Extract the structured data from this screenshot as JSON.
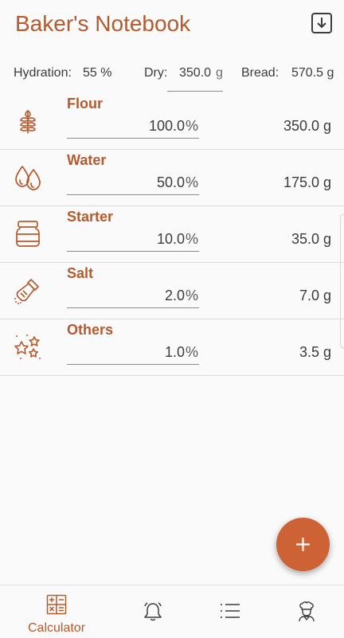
{
  "app": {
    "title": "Baker's Notebook"
  },
  "colors": {
    "accent": "#b55a2c",
    "fab": "#cd6334"
  },
  "summary": {
    "hydration_label": "Hydration:",
    "hydration_value": "55 %",
    "dry_label": "Dry:",
    "dry_value": "350.0",
    "dry_unit": "g",
    "bread_label": "Bread:",
    "bread_value": "570.5 g"
  },
  "ingredients": [
    {
      "name": "Flour",
      "percent": "100.0",
      "percent_unit": "%",
      "grams": "350.0 g",
      "icon": "wheat-icon"
    },
    {
      "name": "Water",
      "percent": "50.0",
      "percent_unit": "%",
      "grams": "175.0 g",
      "icon": "water-drops-icon"
    },
    {
      "name": "Starter",
      "percent": "10.0",
      "percent_unit": "%",
      "grams": "35.0 g",
      "icon": "jar-icon"
    },
    {
      "name": "Salt",
      "percent": "2.0",
      "percent_unit": "%",
      "grams": "7.0 g",
      "icon": "salt-shaker-icon"
    },
    {
      "name": "Others",
      "percent": "1.0",
      "percent_unit": "%",
      "grams": "3.5 g",
      "icon": "sparkle-stars-icon"
    }
  ],
  "fab": {
    "icon": "plus-icon"
  },
  "nav": {
    "items": [
      {
        "label": "Calculator",
        "icon": "calculator-icon",
        "active": true
      },
      {
        "label": "",
        "icon": "bell-icon"
      },
      {
        "label": "",
        "icon": "list-icon"
      },
      {
        "label": "",
        "icon": "chef-icon"
      }
    ]
  }
}
